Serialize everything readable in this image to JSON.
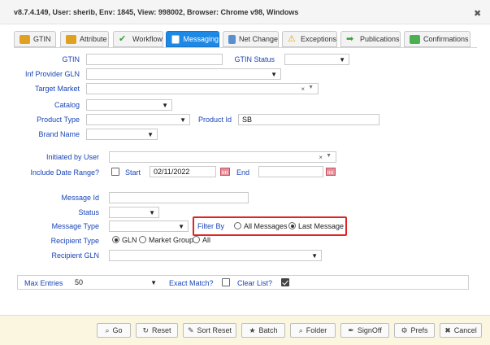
{
  "window": {
    "title": "v8.7.4.149, User: sherib, Env: 1845, View: 998002, Browser: Chrome v98, Windows",
    "close_label": "✖"
  },
  "tabs": [
    {
      "label": "GTIN",
      "icon": "gtin-icon",
      "active": false
    },
    {
      "label": "Attribute",
      "icon": "attribute-icon",
      "active": false
    },
    {
      "label": "Workflow",
      "icon": "check-icon",
      "active": false
    },
    {
      "label": "Messaging",
      "icon": "messaging-icon",
      "active": true
    },
    {
      "label": "Net Change",
      "icon": "net-change-icon",
      "active": false
    },
    {
      "label": "Exceptions",
      "icon": "warning-icon",
      "active": false
    },
    {
      "label": "Publications",
      "icon": "arrow-icon",
      "active": false
    },
    {
      "label": "Confirmations",
      "icon": "handshake-icon",
      "active": false
    }
  ],
  "form": {
    "gtin": {
      "label": "GTIN",
      "value": ""
    },
    "gtin_status": {
      "label": "GTIN Status",
      "value": ""
    },
    "inf_provider_gln": {
      "label": "Inf Provider GLN",
      "value": ""
    },
    "target_market": {
      "label": "Target Market",
      "value": ""
    },
    "catalog": {
      "label": "Catalog",
      "value": ""
    },
    "product_type": {
      "label": "Product Type",
      "value": ""
    },
    "product_id": {
      "label": "Product Id",
      "value": "SB"
    },
    "brand_name": {
      "label": "Brand Name",
      "value": ""
    },
    "initiated_by_user": {
      "label": "Initiated by User",
      "value": ""
    },
    "include_date_range": {
      "label": "Include Date Range?",
      "checked": false
    },
    "start": {
      "label": "Start",
      "value": "02/11/2022"
    },
    "end": {
      "label": "End",
      "value": ""
    },
    "message_id": {
      "label": "Message Id",
      "value": ""
    },
    "status": {
      "label": "Status",
      "value": ""
    },
    "message_type": {
      "label": "Message Type",
      "value": ""
    },
    "filter_by": {
      "label": "Filter By",
      "options": [
        "All Messages",
        "Last Message"
      ],
      "selected": "Last Message"
    },
    "recipient_type": {
      "label": "Recipient Type",
      "options": [
        "GLN",
        "Market Group",
        "All"
      ],
      "selected": "GLN"
    },
    "recipient_gln": {
      "label": "Recipient GLN",
      "value": ""
    },
    "max_entries": {
      "label": "Max Entries",
      "value": "50"
    },
    "exact_match": {
      "label": "Exact Match?",
      "checked": false
    },
    "clear_list": {
      "label": "Clear List?",
      "checked": true
    }
  },
  "buttons": [
    {
      "label": "Go",
      "icon": "binoculars-icon"
    },
    {
      "label": "Reset",
      "icon": "reset-icon"
    },
    {
      "label": "Sort Reset",
      "icon": "pencil-icon"
    },
    {
      "label": "Batch",
      "icon": "star-icon"
    },
    {
      "label": "Folder",
      "icon": "folder-icon"
    },
    {
      "label": "SignOff",
      "icon": "signoff-icon"
    },
    {
      "label": "Prefs",
      "icon": "gear-icon"
    },
    {
      "label": "Cancel",
      "icon": "close-icon"
    }
  ],
  "colors": {
    "label_blue": "#1a45b8",
    "active_tab": "#1e88e5",
    "highlight_box": "#e02424",
    "footer_bg": "#faf6df"
  }
}
